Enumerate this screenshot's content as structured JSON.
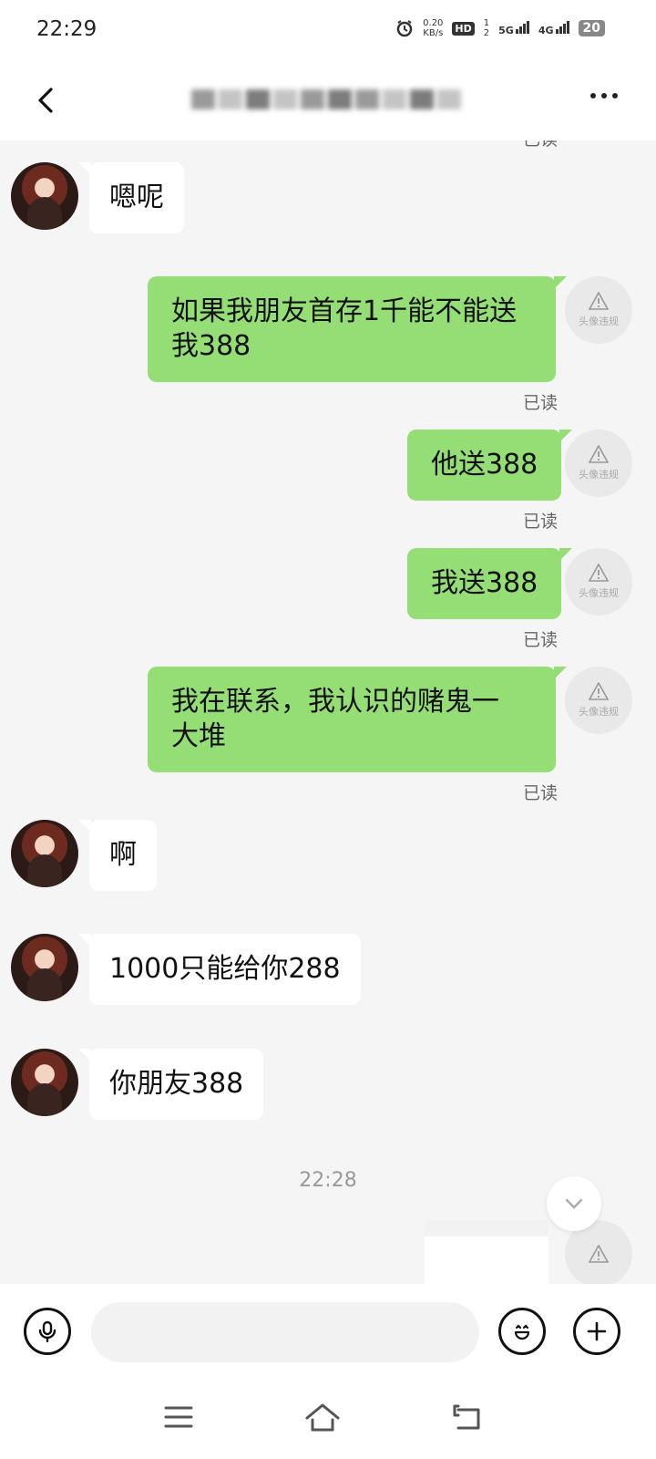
{
  "status": {
    "time": "22:29",
    "net_speed_value": "0.20",
    "net_speed_unit": "KB/s",
    "hd": "HD",
    "sim1": "1",
    "sim2": "2",
    "net1": "5G",
    "net2": "4G",
    "battery": "20"
  },
  "header": {
    "title": ""
  },
  "messages": [
    {
      "side": "in",
      "text": "嗯呢"
    },
    {
      "side": "out",
      "line1": "如果我朋友首存1千能不能送",
      "line2": "我388",
      "read": "已读",
      "warn": "头像违规"
    },
    {
      "side": "out",
      "text": "他送388",
      "read": "已读",
      "warn": "头像违规"
    },
    {
      "side": "out",
      "text": "我送388",
      "read": "已读",
      "warn": "头像违规"
    },
    {
      "side": "out",
      "line1": "我在联系，我认识的赌鬼一",
      "line2": "大堆",
      "read": "已读",
      "warn": "头像违规"
    },
    {
      "side": "in",
      "text": "啊"
    },
    {
      "side": "in",
      "text": "1000只能给你288"
    },
    {
      "side": "in",
      "text": "你朋友388"
    }
  ],
  "timestamp": "22:28",
  "top_partial_read": "已读",
  "input": {
    "value": "",
    "placeholder": ""
  },
  "colors": {
    "outgoing_bubble": "#95de76",
    "incoming_bubble": "#ffffff",
    "background": "#f5f5f5"
  },
  "icons": {
    "back": "chevron-left-icon",
    "more": "more-dots-icon",
    "voice": "microphone-icon",
    "emoji": "emoji-icon",
    "plus": "plus-icon",
    "warning": "warning-triangle-icon",
    "nav_menu": "menu-icon",
    "nav_home": "home-icon",
    "nav_back": "back-icon"
  }
}
